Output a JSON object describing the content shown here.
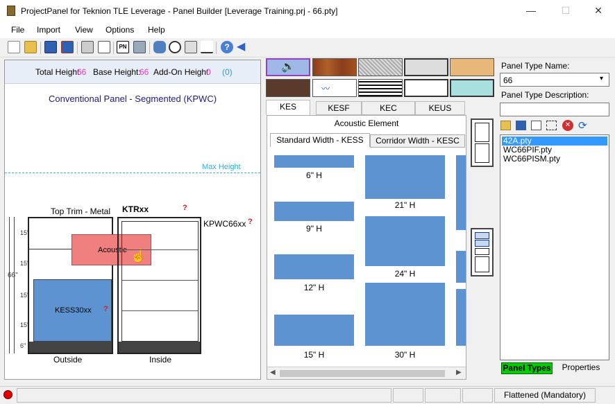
{
  "window": {
    "title": "ProjectPanel for Teknion TLE Leverage - Panel Builder [Leverage Training.prj - 66.pty]",
    "minimize": "—",
    "maximize": "☐",
    "close": "✕"
  },
  "menu": [
    "File",
    "Import",
    "View",
    "Options",
    "Help"
  ],
  "toolbar": {
    "pn_label": "PN"
  },
  "left": {
    "total_height_label": "Total Height",
    "total_height_value": "66",
    "base_height_label": "Base Height:",
    "base_height_value": "66",
    "addon_label": "Add-On Height",
    "addon_value": "0",
    "addon_paren": "(0)",
    "panel_title": "Conventional Panel - Segmented (KPWC)",
    "max_height": "Max Height",
    "top_trim": "Top Trim - Metal",
    "ktr": "KTRxx",
    "kpwc": "KPWC66xx",
    "q": "?",
    "acoustic": "Acoustic",
    "kess": "KESS30xx",
    "outside": "Outside",
    "inside": "Inside",
    "dims": [
      "15\"",
      "15\"",
      "15\"",
      "15\"",
      "6\""
    ],
    "total_dim": "66\""
  },
  "tabs": [
    "KES",
    "KESF",
    "KEC",
    "KEUS"
  ],
  "middle": {
    "header": "Acoustic Element",
    "subtabs": [
      "Standard Width - KESS",
      "Corridor Width - KESC"
    ],
    "col1": [
      "6\"  H",
      "9\"  H",
      "12\"  H",
      "15\"  H"
    ],
    "col2": [
      "21\"  H",
      "24\"  H",
      "30\"  H"
    ]
  },
  "right": {
    "type_name_label": "Panel Type Name:",
    "type_name_value": "66",
    "type_desc_label": "Panel Type Description:",
    "type_desc_value": "",
    "files": [
      "42A.pty",
      "WC66PIF.pty",
      "WC66PISM.pty"
    ],
    "tab_panel_types": "Panel Types",
    "tab_properties": "Properties"
  },
  "status": {
    "text": "Flattened (Mandatory)"
  },
  "colors": {
    "accent_pink": "#e040c0",
    "element_blue": "#5e93d1",
    "acoustic_red": "#f08080",
    "select_blue": "#3399ff",
    "green_tab": "#00cc00"
  }
}
